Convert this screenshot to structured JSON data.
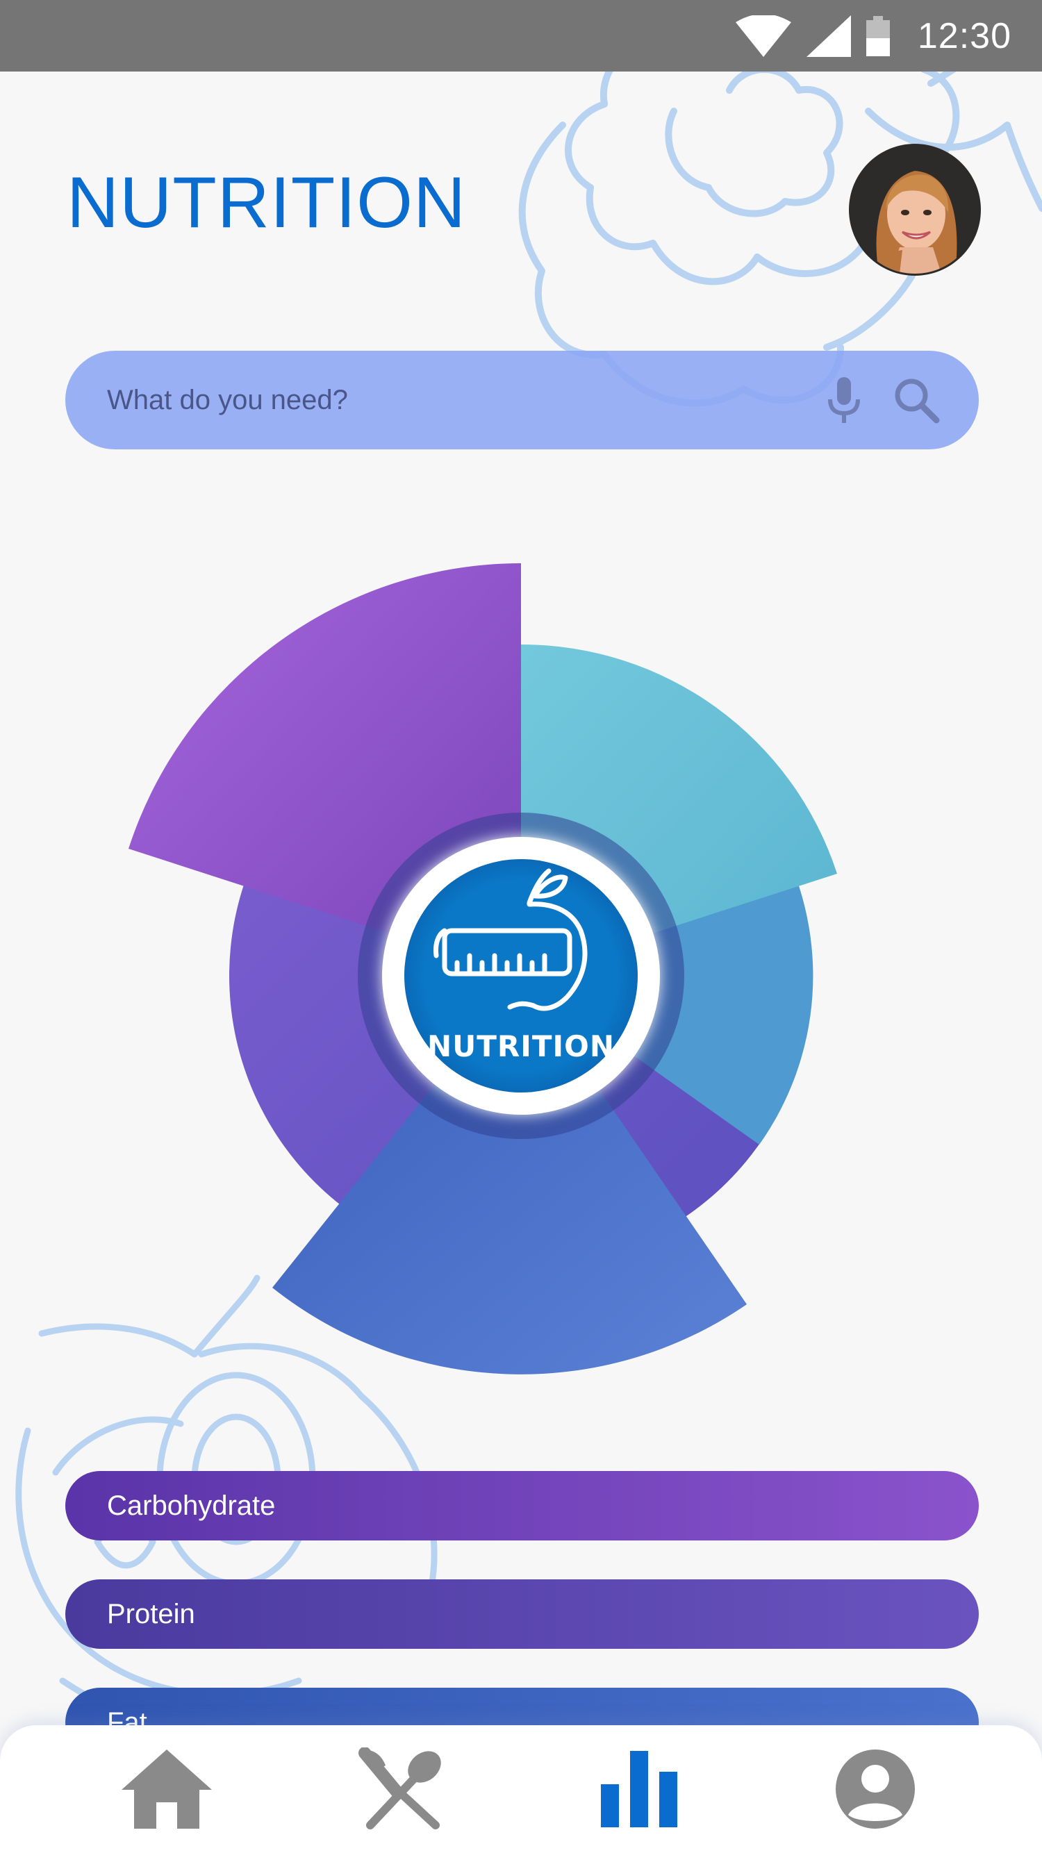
{
  "status_bar": {
    "time": "12:30",
    "icons": [
      "wifi-icon",
      "cellular-signal-icon",
      "battery-icon"
    ]
  },
  "header": {
    "title": "NUTRITION",
    "avatar": "user-avatar"
  },
  "search": {
    "placeholder": "What do you need?",
    "value": "",
    "icons": [
      "microphone-icon",
      "search-icon"
    ]
  },
  "chart": {
    "center_label": "NUTRITION",
    "center_icon": "apple-measuring-tape-icon"
  },
  "nutrients": [
    {
      "label": "Carbohydrate"
    },
    {
      "label": "Protein"
    },
    {
      "label": "Fat"
    }
  ],
  "bottom_nav": {
    "items": [
      {
        "name": "home",
        "icon": "home-icon",
        "active": false
      },
      {
        "name": "food",
        "icon": "knife-spoon-icon",
        "active": false
      },
      {
        "name": "stats",
        "icon": "bar-chart-icon",
        "active": true
      },
      {
        "name": "profile",
        "icon": "account-icon",
        "active": false
      }
    ]
  },
  "colors": {
    "accent": "#0a6ccf",
    "status_bar": "#757575",
    "search_bar": "#8ca6f4",
    "nav_inactive": "#8a8a8a",
    "nav_active": "#0a6ccf"
  }
}
